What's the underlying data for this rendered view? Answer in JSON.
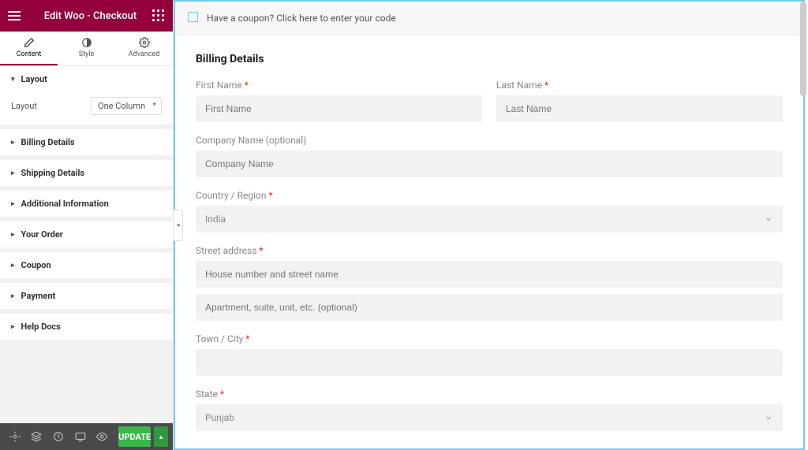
{
  "header": {
    "title": "Edit Woo - Checkout"
  },
  "tabs": {
    "content": "Content",
    "style": "Style",
    "advanced": "Advanced"
  },
  "sections": {
    "layout": {
      "title": "Layout",
      "field_label": "Layout",
      "field_value": "One Column"
    },
    "billing": "Billing Details",
    "shipping": "Shipping Details",
    "additional": "Additional Information",
    "order": "Your Order",
    "coupon": "Coupon",
    "payment": "Payment",
    "help": "Help Docs"
  },
  "footer": {
    "update": "UPDATE"
  },
  "preview": {
    "coupon_text": "Have a coupon? Click here to enter your code",
    "billing_title": "Billing Details",
    "first_name_label": "First Name",
    "first_name_placeholder": "First Name",
    "last_name_label": "Last Name",
    "last_name_placeholder": "Last Name",
    "company_label": "Company Name (optional)",
    "company_placeholder": "Company Name",
    "country_label": "Country / Region",
    "country_value": "India",
    "street_label": "Street address",
    "street_placeholder1": "House number and street name",
    "street_placeholder2": "Apartment, suite, unit, etc. (optional)",
    "town_label": "Town / City",
    "state_label": "State",
    "state_value": "Punjab",
    "required_mark": "*"
  }
}
